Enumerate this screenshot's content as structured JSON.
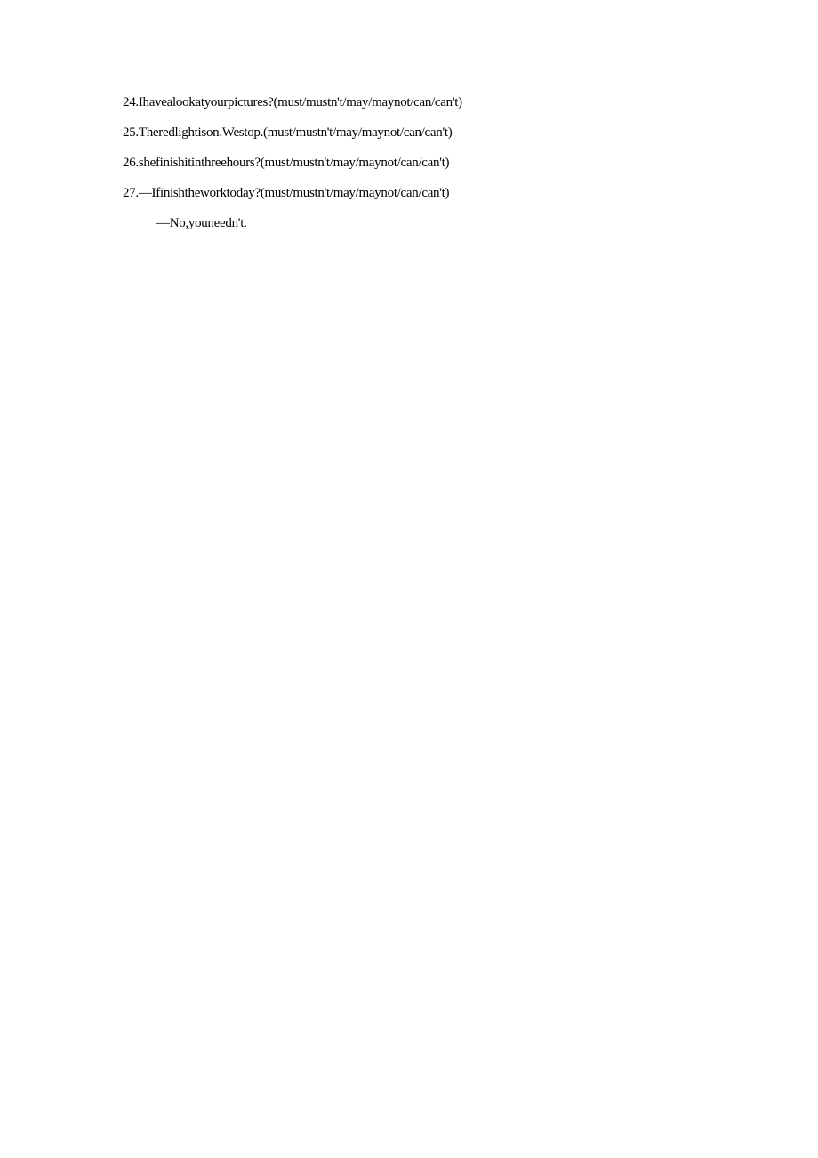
{
  "questions": [
    {
      "number": "24",
      "text": "Ihavealookatyourpictures?(must/mustn't/may/maynot/can/can't)"
    },
    {
      "number": "25",
      "text": "Theredlightison.Westop.(must/mustn't/may/maynot/can/can't)"
    },
    {
      "number": "26",
      "text": "shefinishitinthreehours?(must/mustn't/may/maynot/can/can't)"
    },
    {
      "number": "27",
      "text": "—Ifinishtheworktoday?(must/mustn't/may/maynot/can/can't)",
      "subline": "—No,youneedn't."
    }
  ]
}
